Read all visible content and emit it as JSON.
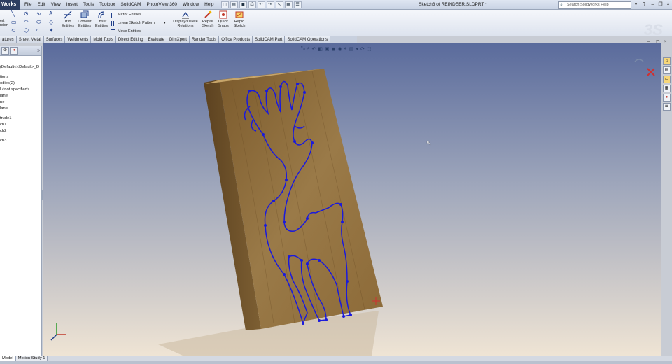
{
  "app": {
    "brand": "Works",
    "menu": [
      "File",
      "Edit",
      "View",
      "Insert",
      "Tools",
      "Toolbox",
      "SolidCAM",
      "PhotoView 360",
      "Window",
      "Help"
    ],
    "document_title": "Sketch3 of REINDEER.SLDPRT *",
    "search_placeholder": "Search SolidWorks Help"
  },
  "ribbon": {
    "convert_left": "ert",
    "convert_left2": "rsion",
    "trim_line1": "Trim",
    "trim_line2": "Entities",
    "convert_line1": "Convert",
    "convert_line2": "Entities",
    "offset_line1": "Offset",
    "offset_line2": "Entities",
    "mirror": "Mirror Entities",
    "linear_pattern": "Linear Sketch Pattern",
    "move": "Move Entities",
    "display_line1": "Display/Delete",
    "display_line2": "Relations",
    "repair_line1": "Repair",
    "repair_line2": "Sketch",
    "quick_line1": "Quick",
    "quick_line2": "Snaps",
    "rapid_line1": "Rapid",
    "rapid_line2": "Sketch"
  },
  "tabs": [
    "atures",
    "Sheet Metal",
    "Surfaces",
    "Weldments",
    "Mold Tools",
    "Direct Editing",
    "Evaluate",
    "DimXpert",
    "Render Tools",
    "Office Products",
    "SolidCAM Part",
    "SolidCAM Operations"
  ],
  "tree": {
    "config": "(Default<<Default>_D",
    "items": [
      "tions",
      "odies(2)",
      "l <not specified>",
      "lane",
      "ne",
      "lane",
      "",
      "trude1",
      "ch1",
      "ch2",
      "",
      "ch3"
    ]
  },
  "bottom_tabs": [
    "Model",
    "Motion Study 1"
  ],
  "colors": {
    "sketch": "#1a1adc",
    "wood": "#8a6a3c",
    "viewport_top": "#5c6ea0",
    "viewport_bottom": "#e8dccb"
  }
}
